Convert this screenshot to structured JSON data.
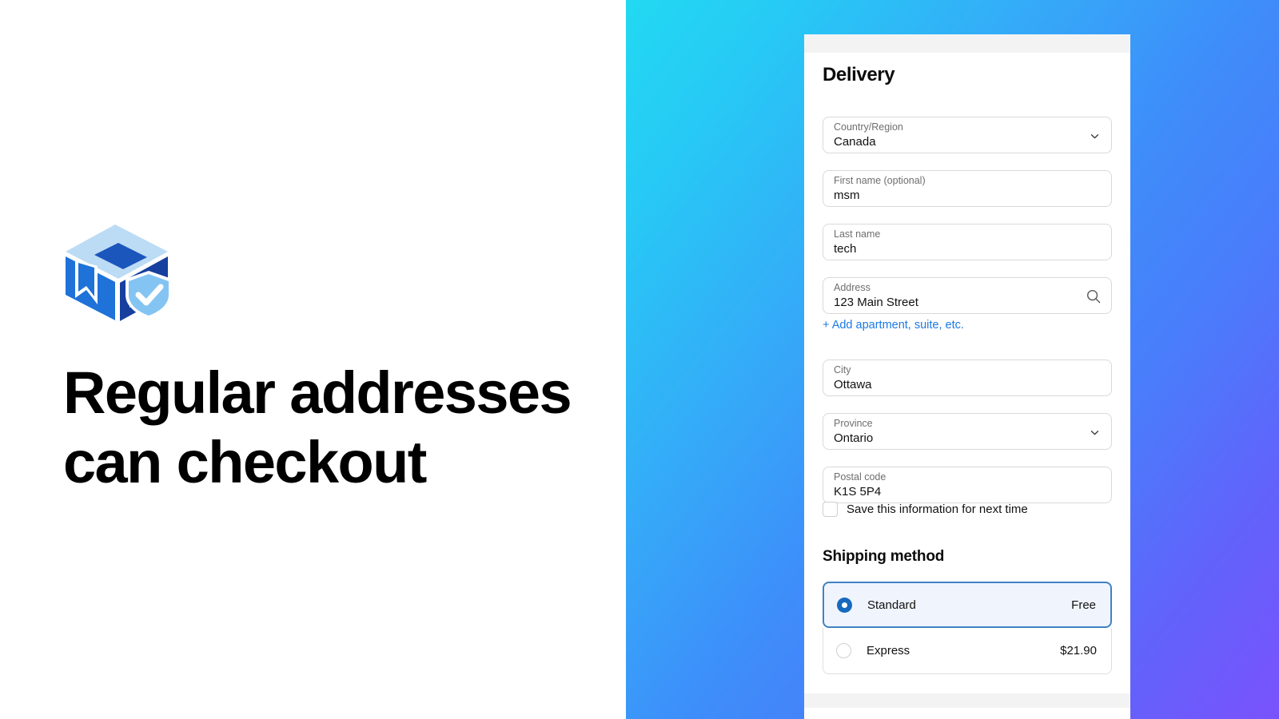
{
  "left": {
    "headline_line1": "Regular addresses",
    "headline_line2": "can checkout",
    "illustration_name": "package-with-shield-illustration"
  },
  "theme": {
    "gradient_start": "#22d9f2",
    "gradient_mid": "#3e8dfa",
    "gradient_end": "#7a52fc",
    "link_blue": "#1c7ae4",
    "selected_border": "#3f82c6",
    "selected_bg": "#f0f5fd",
    "radio_fill": "#1769bd",
    "card_bar_gray": "#f3f3f3",
    "field_border": "#d9d9d9"
  },
  "checkout": {
    "delivery": {
      "title": "Delivery",
      "fields": [
        {
          "label": "Country/Region",
          "value": "Canada",
          "icon": "chevron-down-icon",
          "name": "country-region-select"
        },
        {
          "label": "First name (optional)",
          "value": "msm",
          "icon": "",
          "name": "first-name-field"
        },
        {
          "label": "Last name",
          "value": "tech",
          "icon": "",
          "name": "last-name-field"
        },
        {
          "label": "Address",
          "value": "123 Main Street",
          "icon": "search-icon",
          "name": "address-field"
        },
        {
          "label": "City",
          "value": "Ottawa",
          "icon": "",
          "name": "city-field"
        },
        {
          "label": "Province",
          "value": "Ontario",
          "icon": "chevron-down-icon",
          "name": "province-select"
        },
        {
          "label": "Postal code",
          "value": "K1S 5P4",
          "icon": "",
          "name": "postal-code-field"
        }
      ],
      "add_apartment_link": "+ Add apartment, suite, etc.",
      "save_checkbox_label": "Save this information for next time",
      "save_checkbox_checked": false
    },
    "shipping": {
      "title": "Shipping method",
      "options": [
        {
          "label": "Standard",
          "price": "Free",
          "selected": true
        },
        {
          "label": "Express",
          "price": "$21.90",
          "selected": false
        }
      ]
    }
  }
}
